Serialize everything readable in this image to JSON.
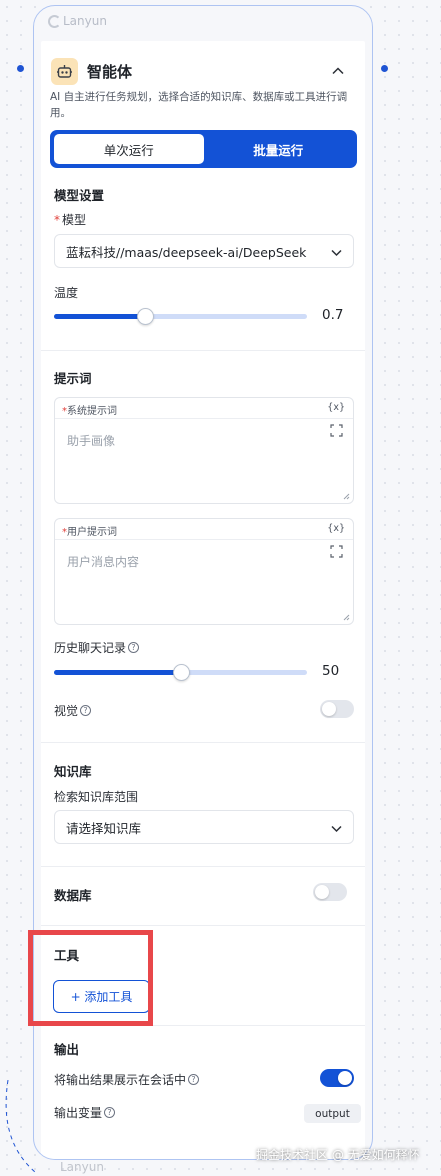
{
  "canvas": {
    "node_watermark": "Lanyun",
    "next_node_watermark": "Lanyun",
    "page_watermark": "掘金技术社区 @ 无爱如何释怀"
  },
  "node": {
    "title": "智能体",
    "description": "AI 自主进行任务规划，选择合适的知识库、数据库或工具进行调用。",
    "tabs": [
      {
        "label": "单次运行",
        "active": true
      },
      {
        "label": "批量运行",
        "active": false
      }
    ]
  },
  "model_settings": {
    "section_title": "模型设置",
    "required_mark": "*",
    "model_label": "模型",
    "model_value": "蓝耘科技//maas/deepseek-ai/DeepSeek",
    "temperature_label": "温度",
    "temperature_value": "0.7",
    "temperature_fraction": 0.36
  },
  "prompts": {
    "section_title": "提示词",
    "system_label": "系统提示词",
    "system_var": "{x}",
    "system_placeholder": "助手画像",
    "user_label": "用户提示词",
    "user_var": "{x}",
    "user_placeholder": "用户消息内容",
    "history_label": "历史聊天记录",
    "history_value": "50",
    "history_fraction": 0.5,
    "vision_label": "视觉",
    "vision_enabled": false
  },
  "knowledge": {
    "section_title": "知识库",
    "search_label": "检索知识库范围",
    "select_value": "请选择知识库"
  },
  "database": {
    "section_title": "数据库",
    "enabled": false
  },
  "tools": {
    "section_title": "工具",
    "add_button": "+ 添加工具"
  },
  "output": {
    "section_title": "输出",
    "show_label": "将输出结果展示在会话中",
    "show_enabled": true,
    "var_label": "输出变量",
    "var_value": "output"
  },
  "colors": {
    "primary": "#1352d6",
    "highlight_border": "#e8474a",
    "required": "#e0403b",
    "agent_icon_bg": "#fbe3b7"
  },
  "icons": {
    "agent": "robot-icon",
    "collapse": "chevron-up-icon",
    "select": "chevron-down-icon",
    "expand": "expand-icon",
    "help": "question-circle-icon"
  }
}
